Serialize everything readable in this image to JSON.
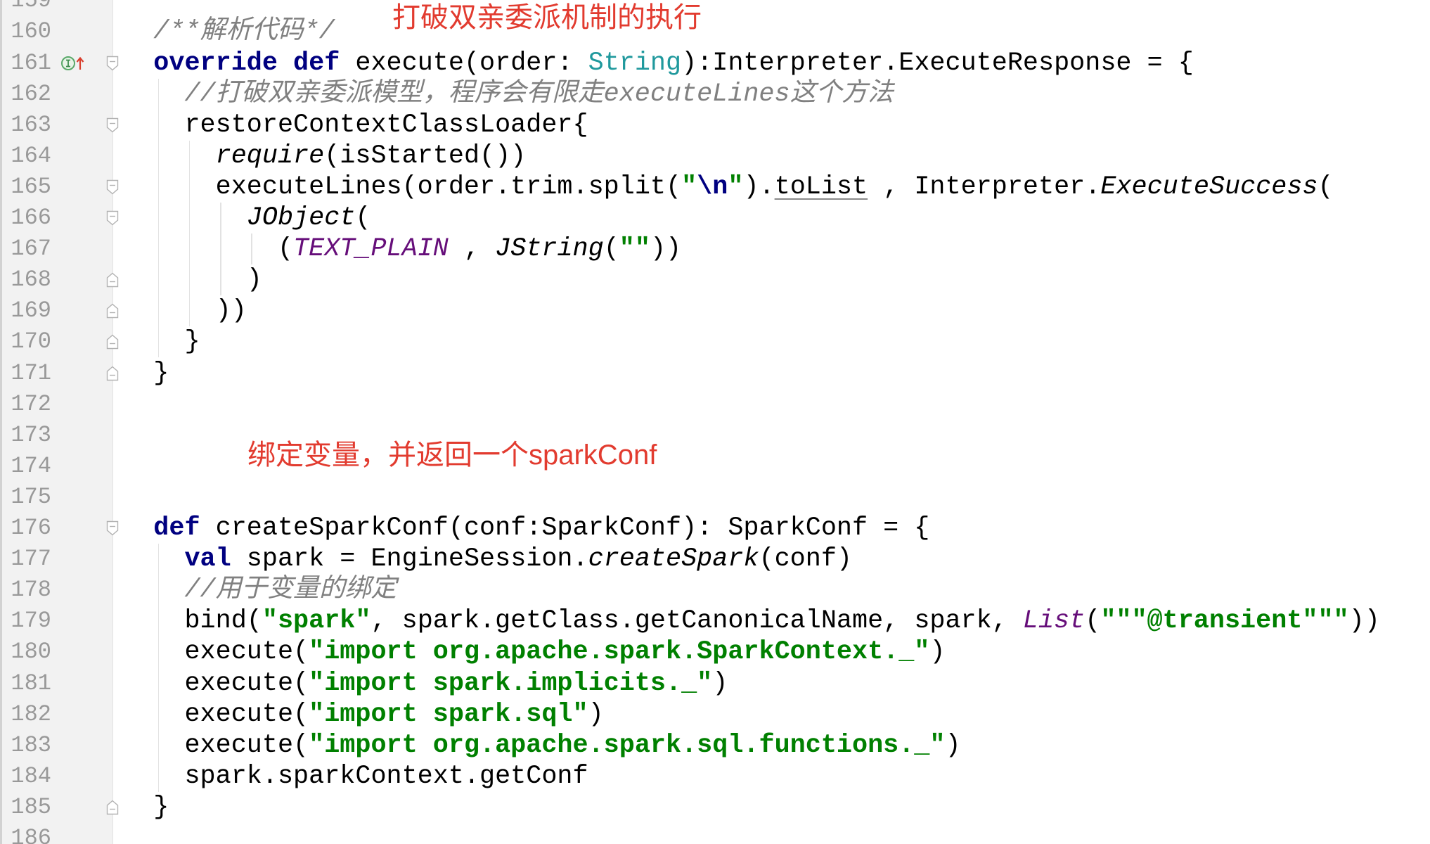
{
  "editor": {
    "theme": {
      "line_number": "#999999",
      "gutter_background": "#f2f2f2",
      "editor_background": "#ffffff",
      "annotation": "#e23b2f"
    },
    "lines": [
      {
        "number": "159",
        "tokens": []
      },
      {
        "number": "160",
        "tokens": [
          {
            "t": "/**解析代码*/",
            "c": "#808080",
            "i": 1
          }
        ]
      },
      {
        "number": "161",
        "fold": "fold-collapse-icon",
        "gutter_icon": "implements-method-icon",
        "tokens": [
          {
            "t": "override",
            "c": "#000080",
            "b": 1
          },
          {
            "t": " "
          },
          {
            "t": "def",
            "c": "#000080",
            "b": 1
          },
          {
            "t": " execute(order: "
          },
          {
            "t": "String",
            "c": "#20999d"
          },
          {
            "t": "):Interpreter.ExecuteResponse = {"
          }
        ]
      },
      {
        "number": "162",
        "tokens": [
          {
            "t": "  "
          },
          {
            "t": "//打破双亲委派模型，程序会有限走executeLines这个方法",
            "c": "#808080",
            "i": 1
          }
        ]
      },
      {
        "number": "163",
        "fold": "fold-collapse-icon",
        "tokens": [
          {
            "t": "  restoreContextClassLoader{"
          }
        ]
      },
      {
        "number": "164",
        "tokens": [
          {
            "t": "    "
          },
          {
            "t": "require",
            "i": 1
          },
          {
            "t": "(isStarted())"
          }
        ]
      },
      {
        "number": "165",
        "fold": "fold-collapse-icon",
        "tokens": [
          {
            "t": "    executeLines(order.trim.split("
          },
          {
            "t": "\"",
            "c": "#008000",
            "b": 1
          },
          {
            "t": "\\n",
            "c": "#000080",
            "b": 1
          },
          {
            "t": "\"",
            "c": "#008000",
            "b": 1
          },
          {
            "t": ")."
          },
          {
            "t": "toList",
            "u": 1
          },
          {
            "t": " , Interpreter."
          },
          {
            "t": "ExecuteSuccess",
            "i": 1
          },
          {
            "t": "("
          }
        ]
      },
      {
        "number": "166",
        "fold": "fold-collapse-icon",
        "tokens": [
          {
            "t": "      "
          },
          {
            "t": "JObject",
            "i": 1
          },
          {
            "t": "("
          }
        ]
      },
      {
        "number": "167",
        "tokens": [
          {
            "t": "        ("
          },
          {
            "t": "TEXT_PLAIN",
            "c": "#660e7a",
            "i": 1
          },
          {
            "t": " , "
          },
          {
            "t": "JString",
            "i": 1
          },
          {
            "t": "("
          },
          {
            "t": "\"\"",
            "c": "#008000",
            "b": 1
          },
          {
            "t": "))"
          }
        ]
      },
      {
        "number": "168",
        "fold": "fold-end-icon",
        "tokens": [
          {
            "t": "      )"
          }
        ]
      },
      {
        "number": "169",
        "fold": "fold-end-icon",
        "tokens": [
          {
            "t": "    ))"
          }
        ]
      },
      {
        "number": "170",
        "fold": "fold-end-icon",
        "tokens": [
          {
            "t": "  }"
          }
        ]
      },
      {
        "number": "171",
        "fold": "fold-end-icon",
        "tokens": [
          {
            "t": "}"
          }
        ]
      },
      {
        "number": "172",
        "tokens": []
      },
      {
        "number": "173",
        "tokens": []
      },
      {
        "number": "174",
        "tokens": []
      },
      {
        "number": "175",
        "tokens": []
      },
      {
        "number": "176",
        "fold": "fold-collapse-icon",
        "tokens": [
          {
            "t": "def",
            "c": "#000080",
            "b": 1
          },
          {
            "t": " createSparkConf(conf:SparkConf): SparkConf = {"
          }
        ]
      },
      {
        "number": "177",
        "tokens": [
          {
            "t": "  "
          },
          {
            "t": "val",
            "c": "#000080",
            "b": 1
          },
          {
            "t": " spark = EngineSession."
          },
          {
            "t": "createSpark",
            "i": 1
          },
          {
            "t": "(conf)"
          }
        ]
      },
      {
        "number": "178",
        "tokens": [
          {
            "t": "  "
          },
          {
            "t": "//用于变量的绑定",
            "c": "#808080",
            "i": 1
          }
        ]
      },
      {
        "number": "179",
        "tokens": [
          {
            "t": "  bind("
          },
          {
            "t": "\"spark\"",
            "c": "#008000",
            "b": 1
          },
          {
            "t": ", spark.getClass.getCanonicalName, spark, "
          },
          {
            "t": "List",
            "c": "#660e7a",
            "i": 1
          },
          {
            "t": "("
          },
          {
            "t": "\"\"\"@transient\"\"\"",
            "c": "#008000",
            "b": 1
          },
          {
            "t": "))"
          }
        ]
      },
      {
        "number": "180",
        "tokens": [
          {
            "t": "  execute("
          },
          {
            "t": "\"import org.apache.spark.SparkContext._\"",
            "c": "#008000",
            "b": 1
          },
          {
            "t": ")"
          }
        ]
      },
      {
        "number": "181",
        "tokens": [
          {
            "t": "  execute("
          },
          {
            "t": "\"import spark.implicits._\"",
            "c": "#008000",
            "b": 1
          },
          {
            "t": ")"
          }
        ]
      },
      {
        "number": "182",
        "tokens": [
          {
            "t": "  execute("
          },
          {
            "t": "\"import spark.sql\"",
            "c": "#008000",
            "b": 1
          },
          {
            "t": ")"
          }
        ]
      },
      {
        "number": "183",
        "tokens": [
          {
            "t": "  execute("
          },
          {
            "t": "\"import org.apache.spark.sql.functions._\"",
            "c": "#008000",
            "b": 1
          },
          {
            "t": ")"
          }
        ]
      },
      {
        "number": "184",
        "tokens": [
          {
            "t": "  spark.sparkContext.getConf"
          }
        ]
      },
      {
        "number": "185",
        "fold": "fold-end-icon",
        "tokens": [
          {
            "t": "}"
          }
        ]
      },
      {
        "number": "186",
        "tokens": []
      }
    ]
  },
  "annotations": {
    "execute_note": "打破双亲委派机制的执行",
    "spark_conf_note": "绑定变量，并返回一个sparkConf"
  }
}
